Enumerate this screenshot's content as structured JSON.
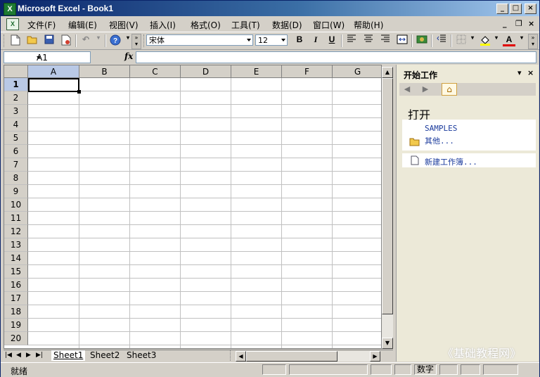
{
  "window": {
    "title": "Microsoft Excel - Book1",
    "app_icon": "X"
  },
  "menu": {
    "items": [
      {
        "label": "文件(F)"
      },
      {
        "label": "编辑(E)"
      },
      {
        "label": "视图(V)"
      },
      {
        "label": "插入(I)"
      },
      {
        "label": "格式(O)"
      },
      {
        "label": "工具(T)"
      },
      {
        "label": "数据(D)"
      },
      {
        "label": "窗口(W)"
      },
      {
        "label": "帮助(H)"
      }
    ]
  },
  "toolbar": {
    "font_name": "宋体",
    "font_size": "12",
    "bold": "B",
    "italic": "I",
    "underline": "U",
    "font_color_glyph": "A"
  },
  "formula_bar": {
    "name_box": "A1",
    "fx_label": "fx",
    "formula": ""
  },
  "sheet": {
    "columns": [
      "A",
      "B",
      "C",
      "D",
      "E",
      "F",
      "G"
    ],
    "rows": [
      "1",
      "2",
      "3",
      "4",
      "5",
      "6",
      "7",
      "8",
      "9",
      "10",
      "11",
      "12",
      "13",
      "14",
      "15",
      "16",
      "17",
      "18",
      "19",
      "20"
    ],
    "active_cell": "A1"
  },
  "tabs": {
    "sheets": [
      "Sheet1",
      "Sheet2",
      "Sheet3"
    ],
    "active": "Sheet1"
  },
  "status": {
    "left": "就绪",
    "mode": "数字"
  },
  "task_pane": {
    "title": "开始工作",
    "section_open": "打开",
    "recent_file": "SAMPLES",
    "more_link": "其他...",
    "new_workbook_link": "新建工作簿..."
  },
  "watermark": "《基础教程网》",
  "colors": {
    "title_start": "#0a246a",
    "title_end": "#a6caf0",
    "link": "#1a3a9c",
    "chrome": "#d4d0c8"
  }
}
